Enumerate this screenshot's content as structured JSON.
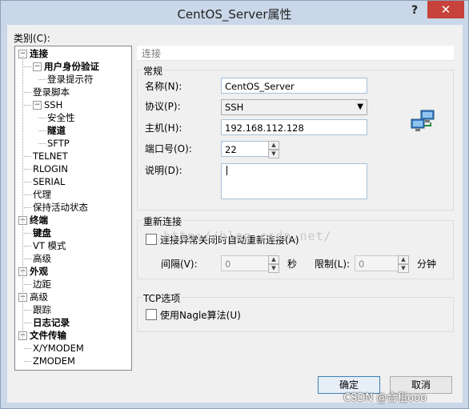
{
  "window": {
    "title": "CentOS_Server属性",
    "help_label": "?",
    "close_label": "✕"
  },
  "category_label": "类别(C):",
  "tree": [
    {
      "label": "连接",
      "bold": true,
      "toggle": "−"
    },
    {
      "label": "用户身份验证",
      "bold": true,
      "toggle": "−"
    },
    {
      "label": "登录提示符",
      "bold": false,
      "toggle": ""
    },
    {
      "label": "登录脚本",
      "bold": false,
      "toggle": ""
    },
    {
      "label": "SSH",
      "bold": false,
      "toggle": "−"
    },
    {
      "label": "安全性",
      "bold": false,
      "toggle": ""
    },
    {
      "label": "隧道",
      "bold": true,
      "toggle": ""
    },
    {
      "label": "SFTP",
      "bold": false,
      "toggle": ""
    },
    {
      "label": "TELNET",
      "bold": false,
      "toggle": ""
    },
    {
      "label": "RLOGIN",
      "bold": false,
      "toggle": ""
    },
    {
      "label": "SERIAL",
      "bold": false,
      "toggle": ""
    },
    {
      "label": "代理",
      "bold": false,
      "toggle": ""
    },
    {
      "label": "保持活动状态",
      "bold": false,
      "toggle": ""
    },
    {
      "label": "终端",
      "bold": true,
      "toggle": "−"
    },
    {
      "label": "键盘",
      "bold": true,
      "toggle": ""
    },
    {
      "label": "VT 模式",
      "bold": false,
      "toggle": ""
    },
    {
      "label": "高级",
      "bold": false,
      "toggle": ""
    },
    {
      "label": "外观",
      "bold": true,
      "toggle": "−"
    },
    {
      "label": "边距",
      "bold": false,
      "toggle": ""
    },
    {
      "label": "高级",
      "bold": false,
      "toggle": "−"
    },
    {
      "label": "跟踪",
      "bold": false,
      "toggle": ""
    },
    {
      "label": "日志记录",
      "bold": true,
      "toggle": ""
    },
    {
      "label": "文件传输",
      "bold": true,
      "toggle": "−"
    },
    {
      "label": "X/YMODEM",
      "bold": false,
      "toggle": ""
    },
    {
      "label": "ZMODEM",
      "bold": false,
      "toggle": ""
    }
  ],
  "panel": {
    "header": "连接",
    "general": {
      "title": "常规",
      "name_label": "名称(N):",
      "name_value": "CentOS_Server",
      "protocol_label": "协议(P):",
      "protocol_value": "SSH",
      "host_label": "主机(H):",
      "host_value": "192.168.112.128",
      "port_label": "端口号(O):",
      "port_value": "22",
      "desc_label": "说明(D):",
      "desc_value": ""
    },
    "reconnect": {
      "title": "重新连接",
      "auto_label": "连接异常关闭时自动重新连接(A)",
      "auto_checked": false,
      "interval_label": "间隔(V):",
      "interval_value": "0",
      "interval_unit": "秒",
      "limit_label": "限制(L):",
      "limit_value": "0",
      "limit_unit": "分钟"
    },
    "tcp": {
      "title": "TCP选项",
      "nagle_label": "使用Nagle算法(U)",
      "nagle_checked": false
    }
  },
  "buttons": {
    "ok": "确定",
    "cancel": "取消"
  },
  "watermark": "http://blog.csdn.net/",
  "credit": "CSDN @合租ooo",
  "colors": {
    "close": "#c7423a",
    "frame": "#c9d7e8"
  }
}
